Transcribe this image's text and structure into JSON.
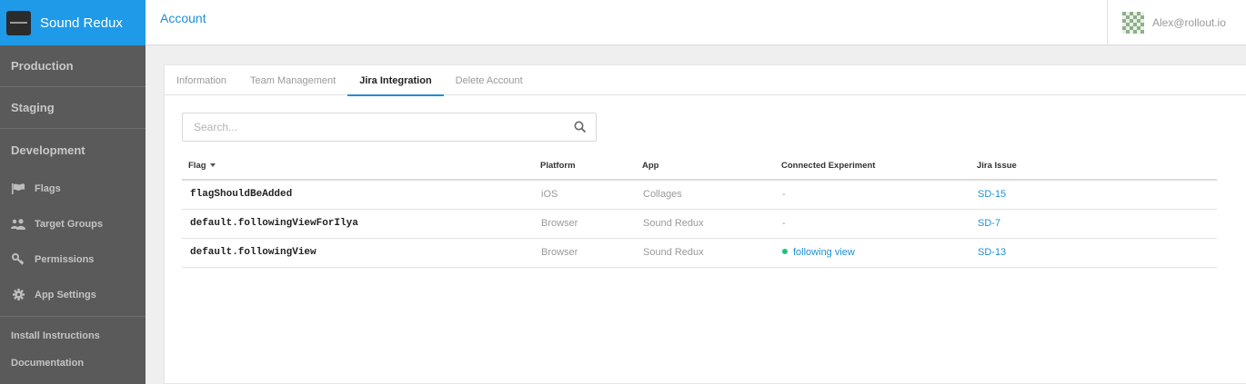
{
  "app": {
    "name": "Sound Redux"
  },
  "sidebar": {
    "environments": [
      {
        "label": "Production"
      },
      {
        "label": "Staging"
      },
      {
        "label": "Development"
      }
    ],
    "nav": [
      {
        "label": "Flags",
        "icon": "flag-icon"
      },
      {
        "label": "Target Groups",
        "icon": "users-icon"
      },
      {
        "label": "Permissions",
        "icon": "key-icon"
      },
      {
        "label": "App Settings",
        "icon": "gear-icon"
      }
    ],
    "links": [
      {
        "label": "Install Instructions"
      },
      {
        "label": "Documentation"
      }
    ]
  },
  "header": {
    "title": "Account",
    "user_email": "Alex@rollout.io"
  },
  "tabs": [
    {
      "label": "Information",
      "active": false
    },
    {
      "label": "Team Management",
      "active": false
    },
    {
      "label": "Jira Integration",
      "active": true
    },
    {
      "label": "Delete Account",
      "active": false
    }
  ],
  "search": {
    "placeholder": "Search..."
  },
  "table": {
    "columns": [
      "Flag",
      "Platform",
      "App",
      "Connected Experiment",
      "Jira Issue"
    ],
    "rows": [
      {
        "flag": "flagShouldBeAdded",
        "platform": "iOS",
        "app": "Collages",
        "experiment": "-",
        "experiment_active": false,
        "jira": "SD-15"
      },
      {
        "flag": "default.followingViewForIlya",
        "platform": "Browser",
        "app": "Sound Redux",
        "experiment": "-",
        "experiment_active": false,
        "jira": "SD-7"
      },
      {
        "flag": "default.followingView",
        "platform": "Browser",
        "app": "Sound Redux",
        "experiment": "following view",
        "experiment_active": true,
        "jira": "SD-13"
      }
    ]
  },
  "colors": {
    "accent": "#1e8fd6",
    "brand": "#1e9ae8",
    "sidebar": "#5a5a5a",
    "status_active": "#1ec27a"
  }
}
